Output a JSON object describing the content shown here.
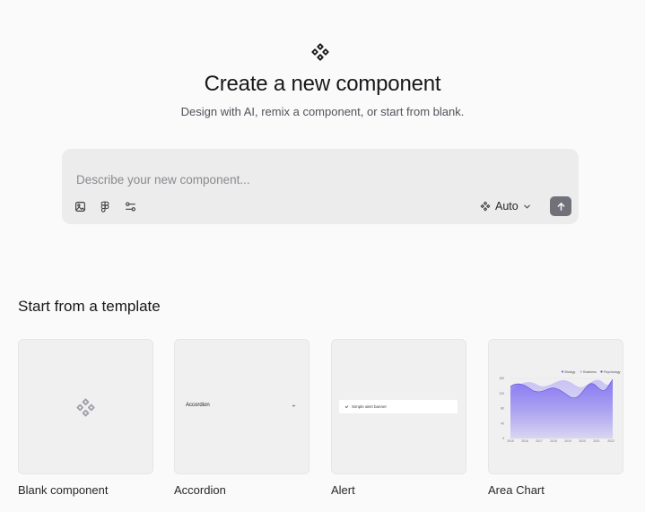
{
  "header": {
    "icon": "components-icon",
    "title": "Create a new component",
    "subtitle": "Design with AI, remix a component, or start from blank."
  },
  "prompt": {
    "placeholder": "Describe your new component...",
    "value": "",
    "tools": [
      "image-icon",
      "figma-icon",
      "settings-sliders-icon"
    ],
    "model": "Auto",
    "send_icon": "arrow-up-icon"
  },
  "templates": {
    "title": "Start from a template",
    "items": [
      {
        "label": "Blank component",
        "icon": "components-icon"
      },
      {
        "label": "Accordion",
        "preview_text": "Accordion"
      },
      {
        "label": "Alert",
        "preview_text": "Simple alert banner"
      },
      {
        "label": "Area Chart"
      }
    ]
  },
  "area_chart_preview": {
    "legend": [
      "Biology",
      "Business",
      "Psychology"
    ],
    "x_ticks": [
      "2015",
      "2016",
      "2017",
      "2018",
      "2019",
      "2020",
      "2021",
      "2022"
    ],
    "y_ticks": [
      "0",
      "40",
      "80",
      "120",
      "160"
    ]
  },
  "colors": {
    "background": "#fafafa",
    "prompt_bg": "#ececec",
    "send_button": "#71717a",
    "chart_purple": "#7c6cf0"
  }
}
